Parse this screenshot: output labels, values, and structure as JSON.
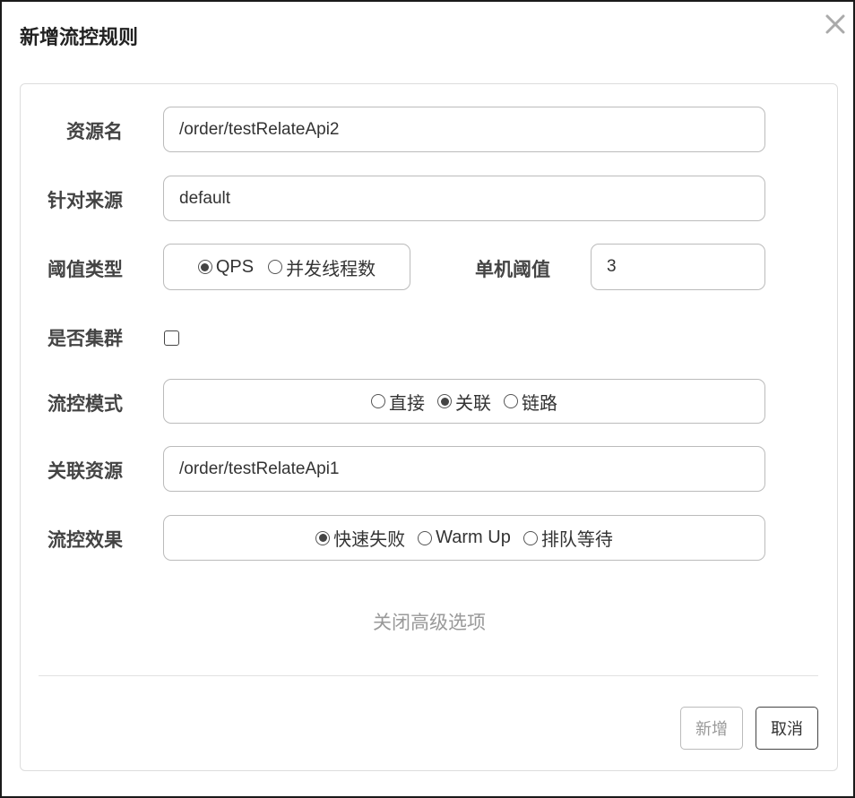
{
  "dialog": {
    "title": "新增流控规则",
    "close_icon": "close-icon"
  },
  "form": {
    "resource": {
      "label": "资源名",
      "value": "/order/testRelateApi2"
    },
    "limit_app": {
      "label": "针对来源",
      "value": "default"
    },
    "grade": {
      "label": "阈值类型",
      "options": [
        "QPS",
        "并发线程数"
      ],
      "selected": "QPS"
    },
    "count": {
      "label": "单机阈值",
      "value": "3"
    },
    "cluster": {
      "label": "是否集群",
      "checked": false
    },
    "strategy": {
      "label": "流控模式",
      "options": [
        "直接",
        "关联",
        "链路"
      ],
      "selected": "关联"
    },
    "ref_resource": {
      "label": "关联资源",
      "value": "/order/testRelateApi1"
    },
    "control_behavior": {
      "label": "流控效果",
      "options": [
        "快速失败",
        "Warm Up",
        "排队等待"
      ],
      "selected": "快速失败"
    },
    "advanced_toggle": "关闭高级选项"
  },
  "footer": {
    "add_label": "新增",
    "cancel_label": "取消"
  }
}
